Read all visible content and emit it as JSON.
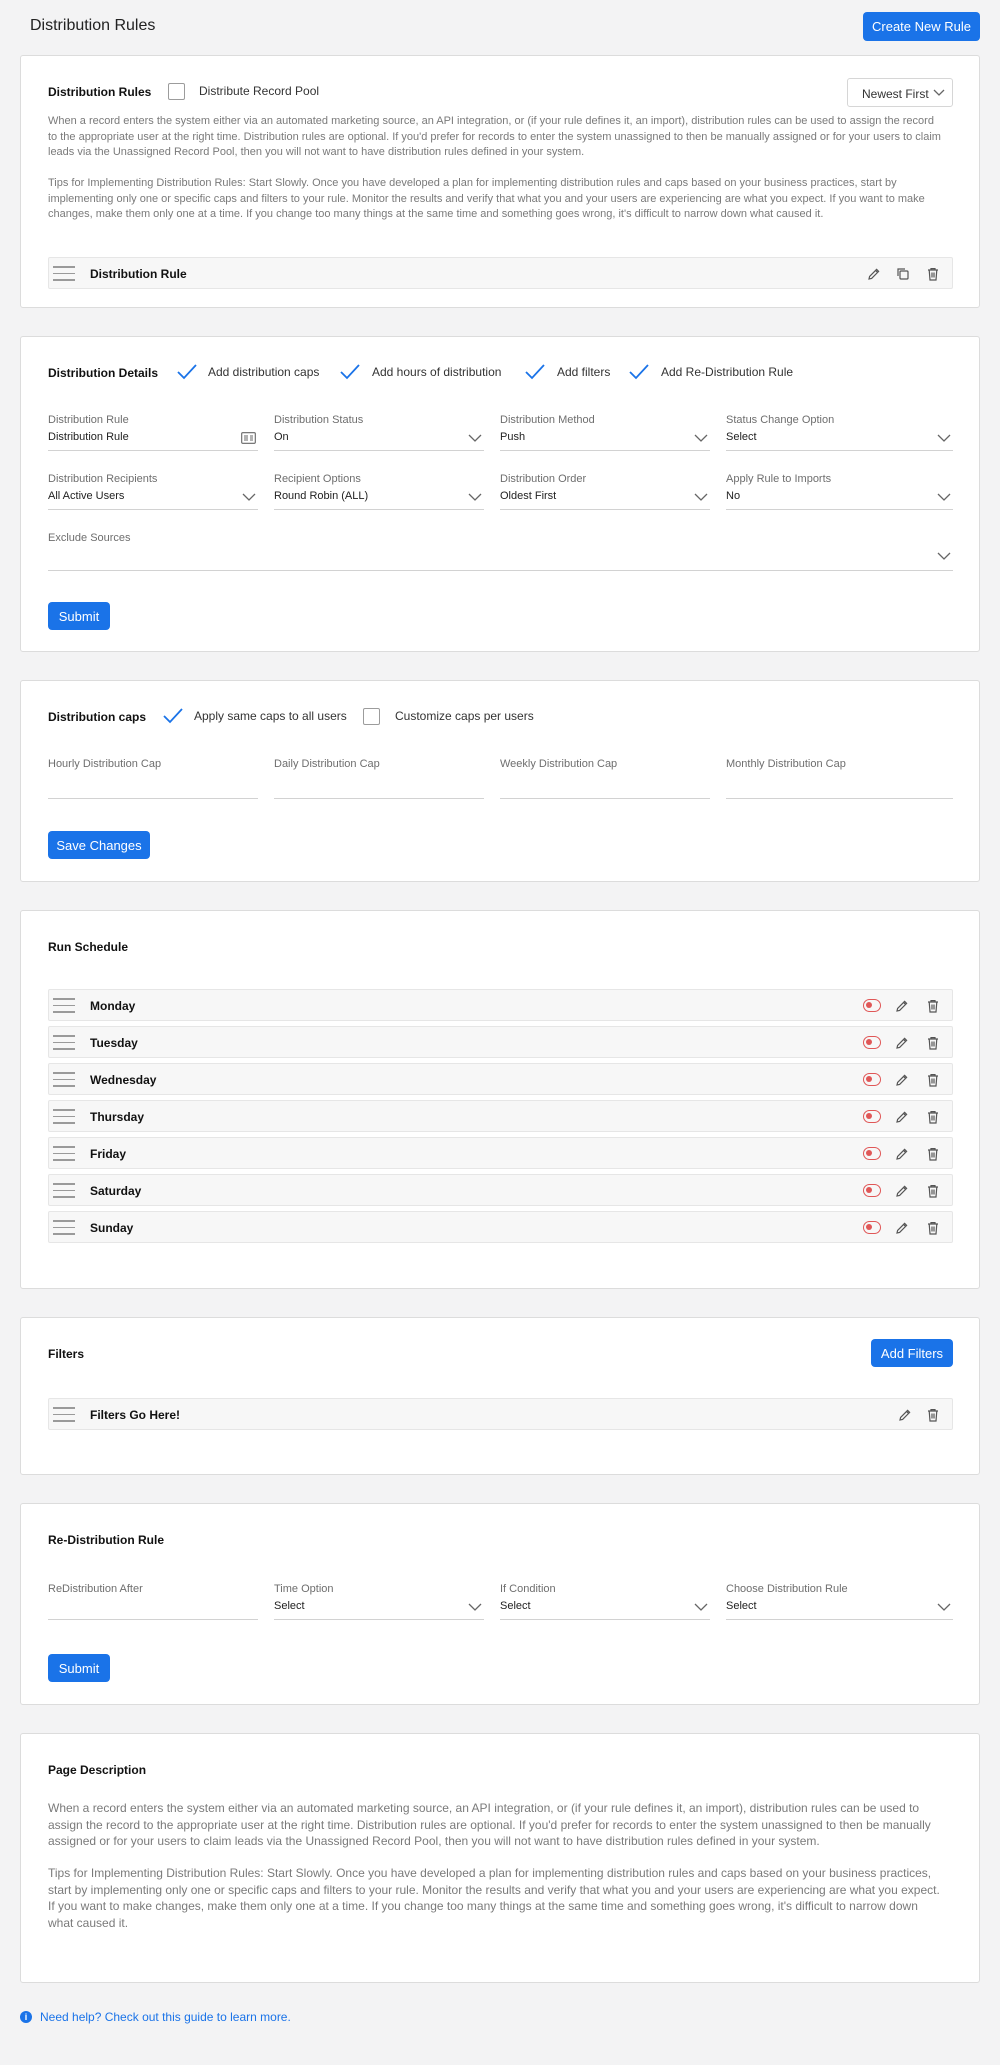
{
  "header": {
    "title": "Distribution Rules",
    "create_button": "Create New Rule"
  },
  "rules_card": {
    "title": "Distribution Rules",
    "pool_checkbox_label": "Distribute Record Pool",
    "pool_checked": false,
    "sort_value": "Newest First",
    "description_1": "When a record enters the system either via an automated marketing source, an API integration, or (if your rule defines it, an import), distribution rules can be used to assign the record to the appropriate user at the right time. Distribution rules are optional. If you'd prefer for records to enter the system unassigned to then be manually assigned or for your users to claim leads via the Unassigned Record Pool, then you will not want to have distribution rules defined in your system.",
    "description_2": "Tips for Implementing Distribution Rules: Start Slowly. Once you have developed a plan for implementing distribution rules and caps based on your business practices, start by implementing only one or specific caps and filters to your rule. Monitor the results and verify that what you and your users are experiencing are what you expect. If you want to make changes, make them only one at a time. If you change too many things at the same time and something goes wrong, it's difficult to narrow down what caused it.",
    "rule_row_label": "Distribution Rule"
  },
  "details_card": {
    "title": "Distribution Details",
    "options": [
      {
        "label": "Add distribution caps",
        "checked": true
      },
      {
        "label": "Add hours of distribution",
        "checked": true
      },
      {
        "label": "Add filters",
        "checked": true
      },
      {
        "label": "Add Re-Distribution Rule",
        "checked": true
      }
    ],
    "fields": [
      {
        "label": "Distribution Rule",
        "value": "Distribution Rule",
        "icon": "id-card-icon"
      },
      {
        "label": "Distribution Status",
        "value": "On",
        "icon": "chevron-down-icon"
      },
      {
        "label": "Distribution Method",
        "value": "Push",
        "icon": "chevron-down-icon"
      },
      {
        "label": "Status Change Option",
        "value": "Select",
        "icon": "chevron-down-icon"
      },
      {
        "label": "Distribution Recipients",
        "value": "All Active Users",
        "icon": "chevron-down-icon"
      },
      {
        "label": "Recipient Options",
        "value": "Round Robin (ALL)",
        "icon": "chevron-down-icon"
      },
      {
        "label": "Distribution Order",
        "value": "Oldest First",
        "icon": "chevron-down-icon"
      },
      {
        "label": "Apply Rule to Imports",
        "value": "No",
        "icon": "chevron-down-icon"
      }
    ],
    "exclude_label": "Exclude Sources",
    "exclude_value": "",
    "submit": "Submit"
  },
  "caps_card": {
    "title": "Distribution caps",
    "same_caps_label": "Apply same caps to all users",
    "same_caps_checked": true,
    "custom_caps_label": "Customize caps per users",
    "custom_caps_checked": false,
    "caps": [
      {
        "label": "Hourly Distribution Cap",
        "value": ""
      },
      {
        "label": "Daily Distribution Cap",
        "value": ""
      },
      {
        "label": "Weekly Distribution Cap",
        "value": ""
      },
      {
        "label": "Monthly Distribution Cap",
        "value": ""
      }
    ],
    "save": "Save Changes"
  },
  "schedule_card": {
    "title": "Run Schedule",
    "days": [
      "Monday",
      "Tuesday",
      "Wednesday",
      "Thursday",
      "Friday",
      "Saturday",
      "Sunday"
    ],
    "toggle_state": "off"
  },
  "filters_card": {
    "title": "Filters",
    "add_button": "Add Filters",
    "row_label": "Filters Go Here!"
  },
  "redistribution_card": {
    "title": "Re-Distribution Rule",
    "fields": [
      {
        "label": "ReDistribution After",
        "value": "",
        "icon": ""
      },
      {
        "label": "Time Option",
        "value": "Select",
        "icon": "chevron-down-icon"
      },
      {
        "label": "If Condition",
        "value": "Select",
        "icon": "chevron-down-icon"
      },
      {
        "label": "Choose Distribution Rule",
        "value": "Select",
        "icon": "chevron-down-icon"
      }
    ],
    "submit": "Submit"
  },
  "description_card": {
    "title": "Page Description",
    "paragraph_1": "When a record enters the system either via an automated marketing source, an API integration, or (if your rule defines it, an import), distribution rules can be used to assign the record to the appropriate user at the right time. Distribution rules are optional. If you'd prefer for records to enter the system unassigned to then be manually assigned or for your users to claim leads via the Unassigned Record Pool, then you will not want to have distribution rules defined in your system.",
    "paragraph_2": "Tips for Implementing Distribution Rules: Start Slowly. Once you have developed a plan for implementing distribution rules and caps based on your business practices, start by implementing only one or specific caps and filters to your rule. Monitor the results and verify that what you and your users are experiencing are what you expect. If you want to make changes, make them only one at a time. If you change too many things at the same time and something goes wrong, it's difficult to narrow down what caused it."
  },
  "help_link": "Need help? Check out this guide to learn more.",
  "colors": {
    "accent": "#1a73e8",
    "toggle_off": "#e05757",
    "background": "#f3f3f4"
  }
}
